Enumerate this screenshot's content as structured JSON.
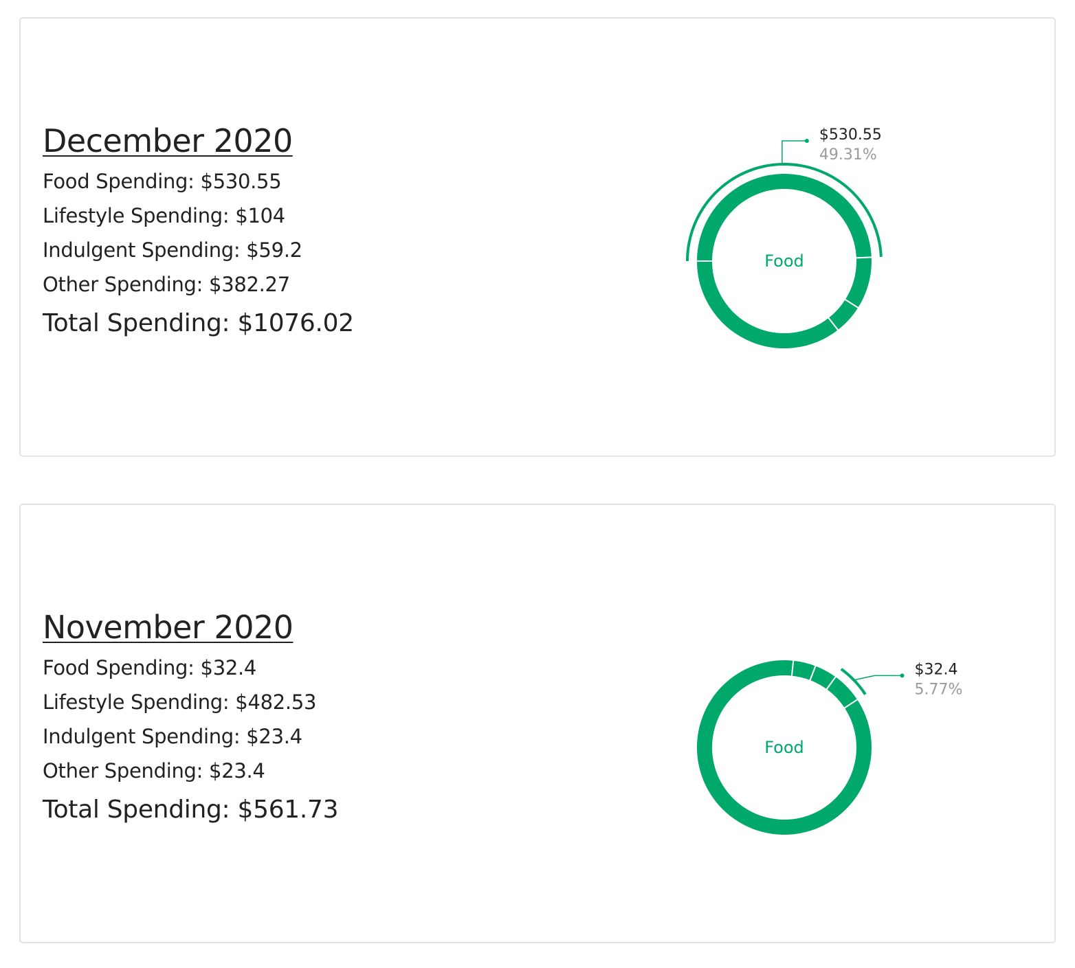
{
  "colors": {
    "accent": "#00a86b",
    "card_border": "#e3e3e3",
    "text": "#222222",
    "muted": "#9a9a9a"
  },
  "months": [
    {
      "title": "December 2020",
      "lines": [
        "Food Spending: $530.55",
        "Lifestyle Spending: $104",
        "Indulgent Spending: $59.2",
        "Other Spending: $382.27"
      ],
      "total": "Total Spending: $1076.02",
      "chart_center_label": "Food",
      "callout_value": "$530.55",
      "callout_pct": "49.31%"
    },
    {
      "title": "November 2020",
      "lines": [
        "Food Spending: $32.4",
        "Lifestyle Spending: $482.53",
        "Indulgent Spending: $23.4",
        "Other Spending: $23.4"
      ],
      "total": "Total Spending: $561.73",
      "chart_center_label": "Food",
      "callout_value": "$32.4",
      "callout_pct": "5.77%"
    }
  ],
  "chart_data": [
    {
      "type": "pie",
      "title": "",
      "categories": [
        "Food",
        "Lifestyle",
        "Indulgent",
        "Other"
      ],
      "values": [
        530.55,
        104,
        59.2,
        382.27
      ],
      "highlighted": "Food"
    },
    {
      "type": "pie",
      "title": "",
      "categories": [
        "Food",
        "Lifestyle",
        "Indulgent",
        "Other"
      ],
      "values": [
        32.4,
        482.53,
        23.4,
        23.4
      ],
      "highlighted": "Food"
    }
  ]
}
